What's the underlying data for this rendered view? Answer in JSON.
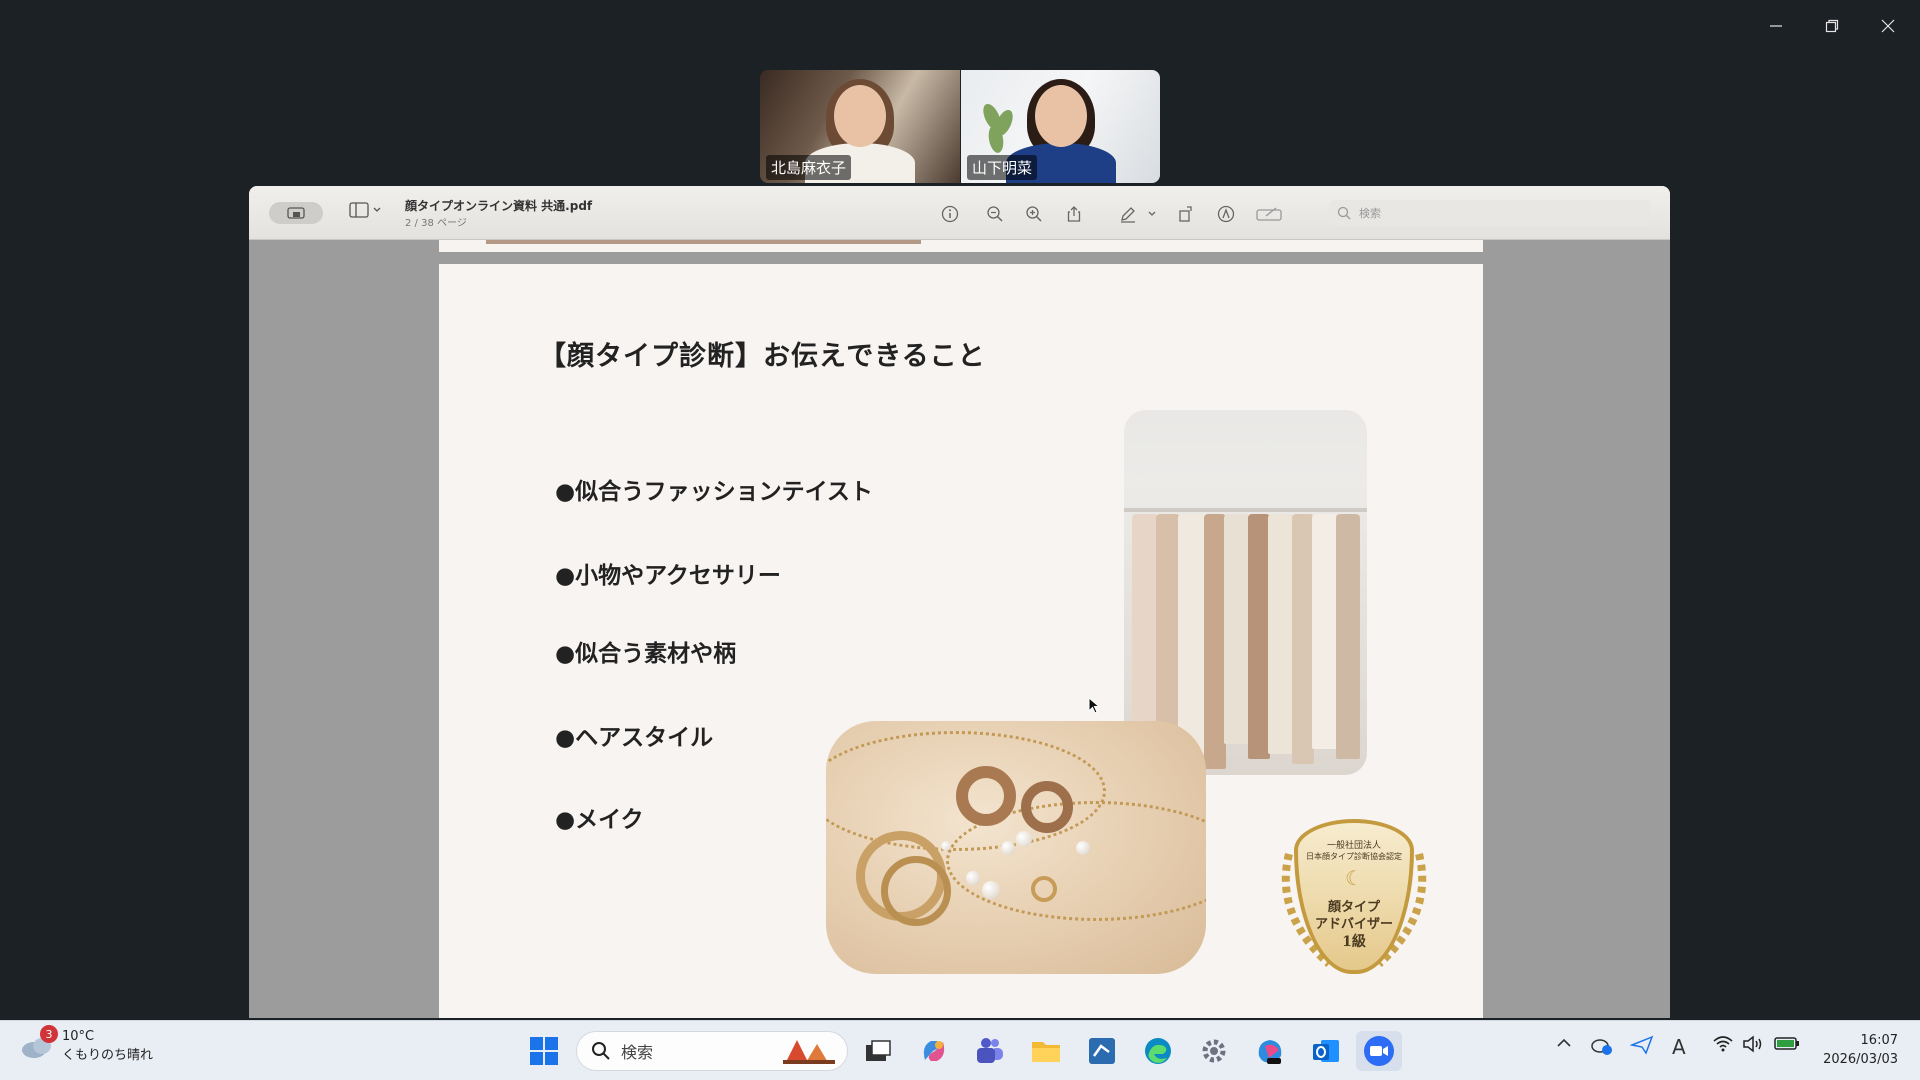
{
  "meeting": {
    "participants": [
      {
        "name": "北島麻衣子"
      },
      {
        "name": "山下明菜"
      }
    ]
  },
  "pdf": {
    "filename": "顔タイプオンライン資料 共通.pdf",
    "page_info": "2 / 38 ページ",
    "search_placeholder": "検索"
  },
  "slide": {
    "title": "【顔タイプ診断】お伝えできること",
    "bullets": [
      "●似合うファッションテイスト",
      "●小物やアクセサリー",
      "●似合う素材や柄",
      "●ヘアスタイル",
      "●メイク"
    ],
    "badge": {
      "line1": "一般社団法人",
      "line2": "日本顔タイプ診断協会認定",
      "line3": "顔タイプ",
      "line4": "アドバイザー",
      "line5": "1級"
    }
  },
  "taskbar": {
    "weather_badge": "3",
    "temperature": "10°C",
    "weather_desc": "くもりのち晴れ",
    "search_placeholder": "検索",
    "time": "16:07",
    "date": "2026/03/03"
  },
  "colors": {
    "background": "#1c2126",
    "taskbar": "#e9eef5",
    "page": "#f8f4f2",
    "accent_gold": "#c49a3e"
  }
}
